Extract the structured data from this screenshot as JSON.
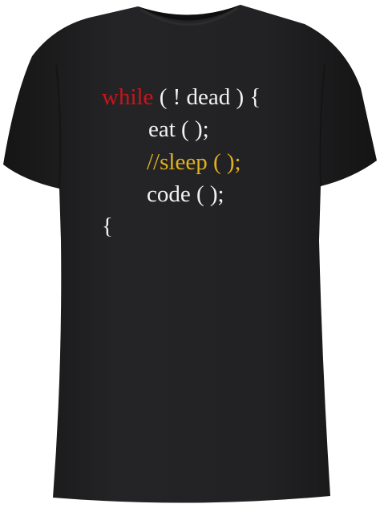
{
  "product": {
    "colors": {
      "shirt": "#1e1e20",
      "text": "#f2f2f2",
      "keyword": "#c8151b",
      "comment": "#e0b020"
    },
    "print": {
      "line1_keyword": "while",
      "line1_rest": " ( ! dead ) {",
      "line2": "eat ( );",
      "line3": "//sleep ( );",
      "line4": "code ( );",
      "line5": "{"
    }
  }
}
